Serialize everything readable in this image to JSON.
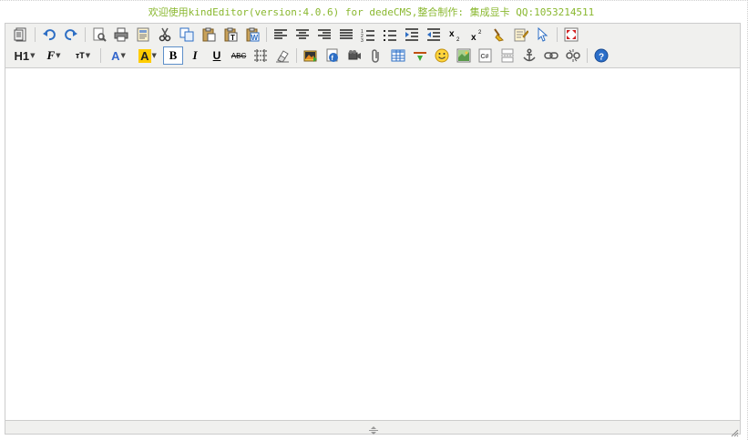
{
  "banner": {
    "text": "欢迎使用kindEditor(version:4.0.6) for dedeCMS,整合制作: 集成显卡 QQ:1053214511",
    "color": "#8ab830"
  },
  "toolbar": {
    "row1": [
      {
        "name": "source-icon"
      },
      {
        "sep": true
      },
      {
        "name": "undo-icon"
      },
      {
        "name": "redo-icon"
      },
      {
        "sep": true
      },
      {
        "name": "preview-icon"
      },
      {
        "name": "print-icon"
      },
      {
        "name": "template-icon"
      },
      {
        "name": "cut-icon"
      },
      {
        "name": "copy-icon"
      },
      {
        "name": "paste-icon"
      },
      {
        "name": "paste-text-icon"
      },
      {
        "name": "paste-word-icon"
      },
      {
        "sep": true
      },
      {
        "name": "align-left-icon"
      },
      {
        "name": "align-center-icon"
      },
      {
        "name": "align-right-icon"
      },
      {
        "name": "align-justify-icon"
      },
      {
        "name": "ordered-list-icon"
      },
      {
        "name": "unordered-list-icon"
      },
      {
        "name": "indent-icon"
      },
      {
        "name": "outdent-icon"
      },
      {
        "name": "subscript-icon"
      },
      {
        "name": "superscript-icon"
      },
      {
        "name": "clear-html-icon"
      },
      {
        "name": "quick-format-icon"
      },
      {
        "name": "select-all-icon"
      },
      {
        "sep": true
      },
      {
        "name": "fullscreen-icon"
      }
    ],
    "row2": [
      {
        "name": "heading-icon",
        "label": "H1"
      },
      {
        "name": "font-family-icon",
        "label": "F"
      },
      {
        "name": "font-size-icon",
        "label": "тT"
      },
      {
        "sep": true
      },
      {
        "name": "font-color-icon",
        "label": "A"
      },
      {
        "name": "highlight-color-icon",
        "label": "A"
      },
      {
        "name": "bold-icon",
        "label": "B",
        "active": true
      },
      {
        "name": "italic-icon",
        "label": "I"
      },
      {
        "name": "underline-icon",
        "label": "U"
      },
      {
        "name": "strikethrough-icon",
        "label": "ABC"
      },
      {
        "name": "line-height-icon"
      },
      {
        "name": "remove-format-icon"
      },
      {
        "sep": true
      },
      {
        "name": "image-icon"
      },
      {
        "name": "flash-icon"
      },
      {
        "name": "media-icon"
      },
      {
        "name": "attachment-icon"
      },
      {
        "name": "table-icon"
      },
      {
        "name": "horizontal-rule-icon"
      },
      {
        "name": "emoticons-icon"
      },
      {
        "name": "baidu-map-icon"
      },
      {
        "name": "code-icon",
        "label": "C#"
      },
      {
        "name": "page-break-icon"
      },
      {
        "name": "anchor-icon"
      },
      {
        "name": "link-icon"
      },
      {
        "name": "unlink-icon"
      },
      {
        "sep": true
      },
      {
        "name": "help-icon"
      }
    ]
  },
  "colors": {
    "toolbar_bg": "#f0f0ee",
    "border": "#cccccc",
    "active_border": "#5d8fc9",
    "highlight_yellow": "#ffcc00",
    "font_color_blue": "#3366cc",
    "help_blue": "#2a6ec9"
  }
}
